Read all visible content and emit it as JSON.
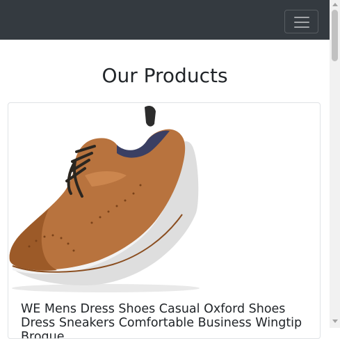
{
  "navbar": {
    "toggler_icon": "hamburger-menu-icon"
  },
  "main": {
    "title": "Our Products"
  },
  "products": [
    {
      "image_subject": "brown leather wingtip oxford sneaker with white sole",
      "title": "WE Mens Dress Shoes Casual Oxford Shoes Dress Sneakers Comfortable Business Wingtip Brogue"
    }
  ],
  "colors": {
    "navbar": "#343a40",
    "page": "#ffffff",
    "text": "#212529"
  }
}
